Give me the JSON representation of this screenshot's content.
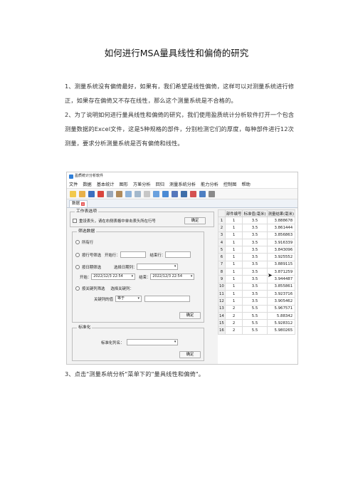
{
  "document": {
    "title": "如何进行MSA量具线性和偏倚的研究",
    "paragraph1": "1、测量系统没有偏倚最好，如果有，我们希望是线性偏倚，这样可以对测量系统进行修正，如果存在偏倚又不存在线性，那么这个测量系统是不合格的。",
    "paragraph2": "2、为了说明如何进行量具线性和偏倚的研究，我们使用盈质统计分析软件打开一个包含测量数据的Excel文件，这是5种规格的部件，分别检测它们的厚度，每种部件进行12次测量，要求分析测量系统是否有偏倚和线性。",
    "paragraph3": "3、点击\"测量系统分析\"菜单下的\"量具线性和偏倚\"。"
  },
  "app": {
    "window_title": "盈质统计分析软件",
    "menu": [
      "文件",
      "数据",
      "基本统计",
      "图形",
      "方差分析",
      "回归",
      "测量系统分析",
      "能力分析",
      "控制图",
      "帮助"
    ],
    "tab_label": "数据",
    "panel": {
      "work_table_label": "工作表选项",
      "reset_header_label": "重设表头，请在右侧表格中单击表头所在行号",
      "confirm_label": "确定",
      "filter_label": "筛选数据",
      "all_rows_label": "所有行",
      "by_row_label": "按行号筛选",
      "start_row_label": "开始行：",
      "end_row_label": "结束行：",
      "by_date_label": "按日期筛选",
      "select_date_col_label": "选择日期列：",
      "start_label": "开始：",
      "end_label": "结束：",
      "start_date": "2022/12/3  22:54",
      "end_date": "2022/12/3  22:54",
      "by_key_label": "按关键列筛选",
      "select_key_col_label": "选择关键列：",
      "key_value_label": "关键列的值",
      "operator": "等于",
      "standardize_label": "标准化",
      "std_col_label": "标准化列名："
    },
    "grid": {
      "headers": [
        "部件编号",
        "标准值(毫米)",
        "测量结果(毫米)"
      ],
      "rows": [
        [
          "1",
          "3.5",
          "3.888678"
        ],
        [
          "1",
          "3.5",
          "3.861444"
        ],
        [
          "1",
          "3.5",
          "3.856863"
        ],
        [
          "1",
          "3.5",
          "3.916339"
        ],
        [
          "1",
          "3.5",
          "3.843096"
        ],
        [
          "1",
          "3.5",
          "3.925552"
        ],
        [
          "1",
          "3.5",
          "3.889115"
        ],
        [
          "1",
          "3.5",
          "3.871259"
        ],
        [
          "1",
          "3.5",
          "3.944487"
        ],
        [
          "1",
          "3.5",
          "3.855861"
        ],
        [
          "1",
          "3.5",
          "3.923716"
        ],
        [
          "1",
          "3.5",
          "3.905462"
        ],
        [
          "2",
          "5.5",
          "5.967571"
        ],
        [
          "2",
          "5.5",
          "5.88342"
        ],
        [
          "2",
          "5.5",
          "5.928312"
        ],
        [
          "2",
          "5.5",
          "5.980265"
        ]
      ]
    }
  }
}
